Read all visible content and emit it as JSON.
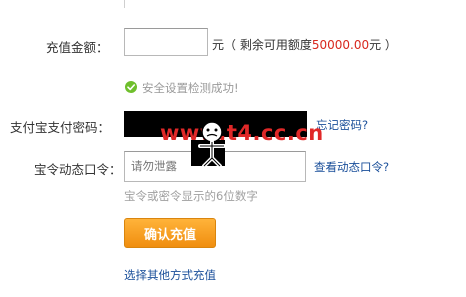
{
  "form": {
    "amount_label": "充值金额：",
    "amount_value": "",
    "unit": "元",
    "quota_prefix": "（ 剩余可用额度",
    "quota_value": "50000.00",
    "quota_suffix": "元 ）",
    "security_ok": "安全设置检测成功!",
    "pay_pwd_label": "支付宝支付密码：",
    "forgot_link": "忘记密码?",
    "token_label": "宝令动态口令：",
    "token_placeholder": "请勿泄露",
    "view_token_link": "查看动态口令?",
    "token_hint": "宝令或密令显示的6位数字",
    "confirm_button": "确认充值",
    "other_methods_link": "选择其他方式充值"
  },
  "watermark": {
    "text": "www.t4.cc.cn"
  },
  "colors": {
    "link": "#1a4f9a",
    "quota_number": "#d8281e",
    "success": "#6fbf2c",
    "button": "#f5a020"
  },
  "icons": {
    "success": "check-circle-icon",
    "watermark": "watermark-logo-icon"
  }
}
